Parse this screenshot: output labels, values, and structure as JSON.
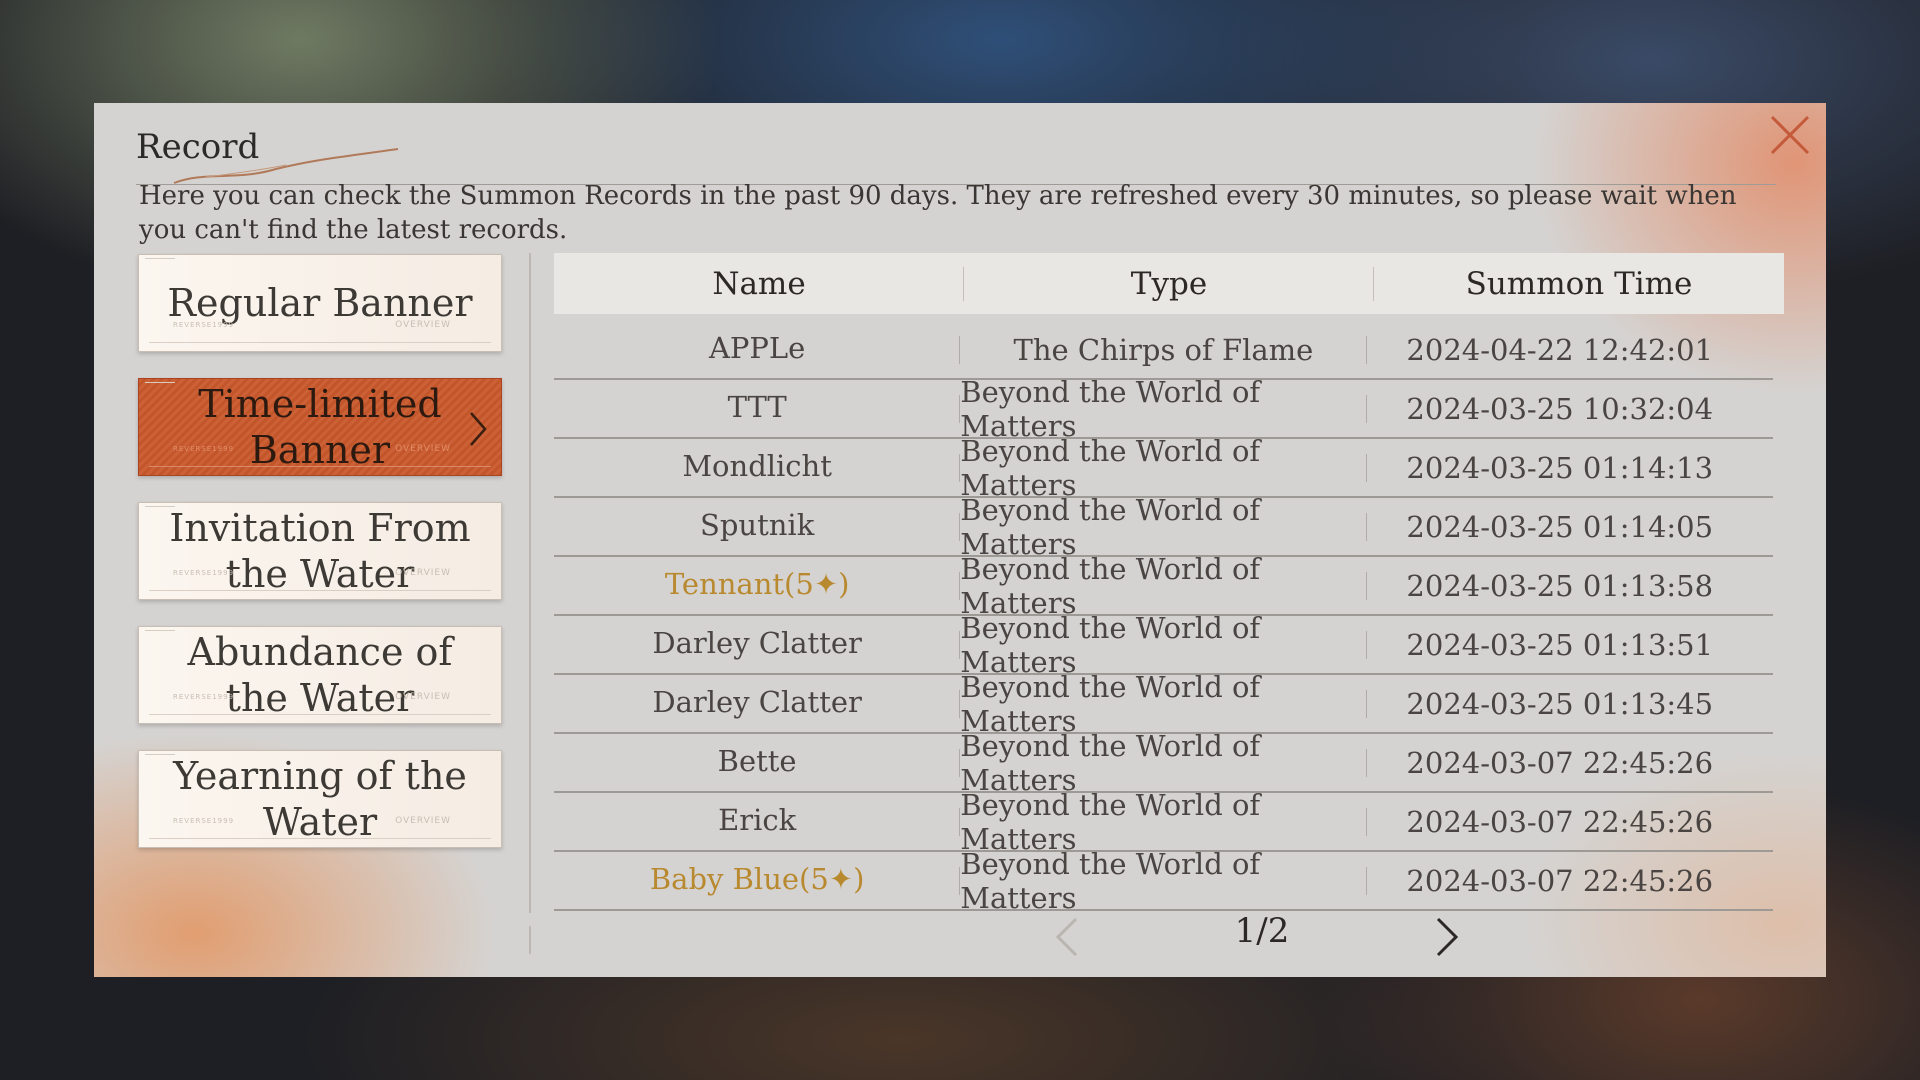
{
  "dialog": {
    "title": "Record",
    "description": "Here you can check the Summon Records in the past 90 days. They are refreshed every 30 minutes, so please wait when you can't find the latest records.",
    "close_icon": "close-icon"
  },
  "tabs": [
    {
      "label": "Regular Banner",
      "active": false
    },
    {
      "label": "Time-limited Banner",
      "active": true
    },
    {
      "label": "Invitation From the Water",
      "active": false
    },
    {
      "label": "Abundance of the Water",
      "active": false
    },
    {
      "label": "Yearning of the Water",
      "active": false
    }
  ],
  "tab_decor": {
    "right": "OVERVIEW",
    "left": "REVERSE1999"
  },
  "table": {
    "headers": {
      "name": "Name",
      "type": "Type",
      "time": "Summon Time"
    },
    "rows": [
      {
        "name": "APPLe",
        "type": "The Chirps of Flame",
        "time": "2024-04-22 12:42:01",
        "highlight": false
      },
      {
        "name": "TTT",
        "type": "Beyond the World of Matters",
        "time": "2024-03-25 10:32:04",
        "highlight": false
      },
      {
        "name": "Mondlicht",
        "type": "Beyond the World of Matters",
        "time": "2024-03-25 01:14:13",
        "highlight": false
      },
      {
        "name": "Sputnik",
        "type": "Beyond the World of Matters",
        "time": "2024-03-25 01:14:05",
        "highlight": false
      },
      {
        "name": "Tennant(5✦)",
        "type": "Beyond the World of Matters",
        "time": "2024-03-25 01:13:58",
        "highlight": true
      },
      {
        "name": "Darley Clatter",
        "type": "Beyond the World of Matters",
        "time": "2024-03-25 01:13:51",
        "highlight": false
      },
      {
        "name": "Darley Clatter",
        "type": "Beyond the World of Matters",
        "time": "2024-03-25 01:13:45",
        "highlight": false
      },
      {
        "name": "Bette",
        "type": "Beyond the World of Matters",
        "time": "2024-03-07 22:45:26",
        "highlight": false
      },
      {
        "name": "Erick",
        "type": "Beyond the World of Matters",
        "time": "2024-03-07 22:45:26",
        "highlight": false
      },
      {
        "name": "Baby Blue(5✦)",
        "type": "Beyond the World of Matters",
        "time": "2024-03-07 22:45:26",
        "highlight": true
      }
    ]
  },
  "pagination": {
    "text": "1/2",
    "prev_icon": "chevron-left-icon",
    "next_icon": "chevron-right-icon"
  },
  "colors": {
    "accent": "#c9582b",
    "gold": "#b8892f",
    "panel": "#d5d3d1"
  }
}
